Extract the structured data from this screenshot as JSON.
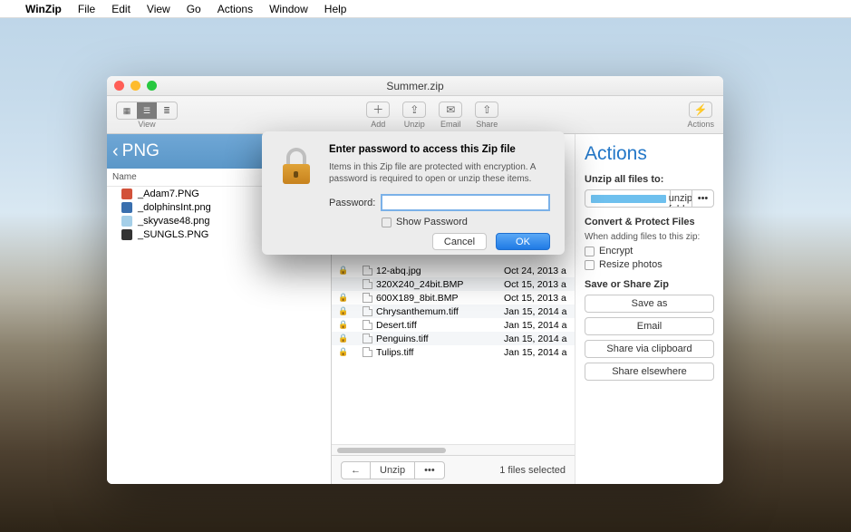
{
  "menubar": {
    "app": "WinZip",
    "items": [
      "File",
      "Edit",
      "View",
      "Go",
      "Actions",
      "Window",
      "Help"
    ]
  },
  "window": {
    "title": "Summer.zip",
    "toolbar": {
      "view_label": "View",
      "add": "Add",
      "unzip": "Unzip",
      "email": "Email",
      "share": "Share",
      "actions": "Actions"
    }
  },
  "sidebar": {
    "breadcrumb": "PNG",
    "header": "Name",
    "items": [
      {
        "label": "_Adam7.PNG"
      },
      {
        "label": "_dolphinsInt.png"
      },
      {
        "label": "_skyvase48.png"
      },
      {
        "label": "_SUNGLS.PNG"
      }
    ]
  },
  "center": {
    "rows": [
      {
        "locked": true,
        "name": "12-abq.jpg",
        "date": "Oct 24, 2013 a"
      },
      {
        "locked": false,
        "name": "320X240_24bit.BMP",
        "date": "Oct 15, 2013 a"
      },
      {
        "locked": true,
        "name": "600X189_8bit.BMP",
        "date": "Oct 15, 2013 a"
      },
      {
        "locked": true,
        "name": "Chrysanthemum.tiff",
        "date": "Jan 15, 2014 a"
      },
      {
        "locked": true,
        "name": "Desert.tiff",
        "date": "Jan 15, 2014 a"
      },
      {
        "locked": true,
        "name": "Penguins.tiff",
        "date": "Jan 15, 2014 a"
      },
      {
        "locked": true,
        "name": "Tulips.tiff",
        "date": "Jan 15, 2014 a"
      }
    ]
  },
  "bottom": {
    "unzip_label": "Unzip",
    "status": "1 files selected"
  },
  "right": {
    "heading": "Actions",
    "unzip_to_label": "Unzip all files to:",
    "last_folder": "Last unzip folder",
    "convert_label": "Convert & Protect Files",
    "convert_hint": "When adding files to this zip:",
    "encrypt": "Encrypt",
    "resize": "Resize photos",
    "save_label": "Save or Share Zip",
    "save_as": "Save as",
    "email": "Email",
    "share_clip": "Share via clipboard",
    "share_else": "Share elsewhere"
  },
  "dialog": {
    "title": "Enter password to access this Zip file",
    "desc": "Items in this Zip file are protected with encryption. A password is required to open or unzip these items.",
    "password_label": "Password:",
    "show_password": "Show Password",
    "cancel": "Cancel",
    "ok": "OK"
  }
}
